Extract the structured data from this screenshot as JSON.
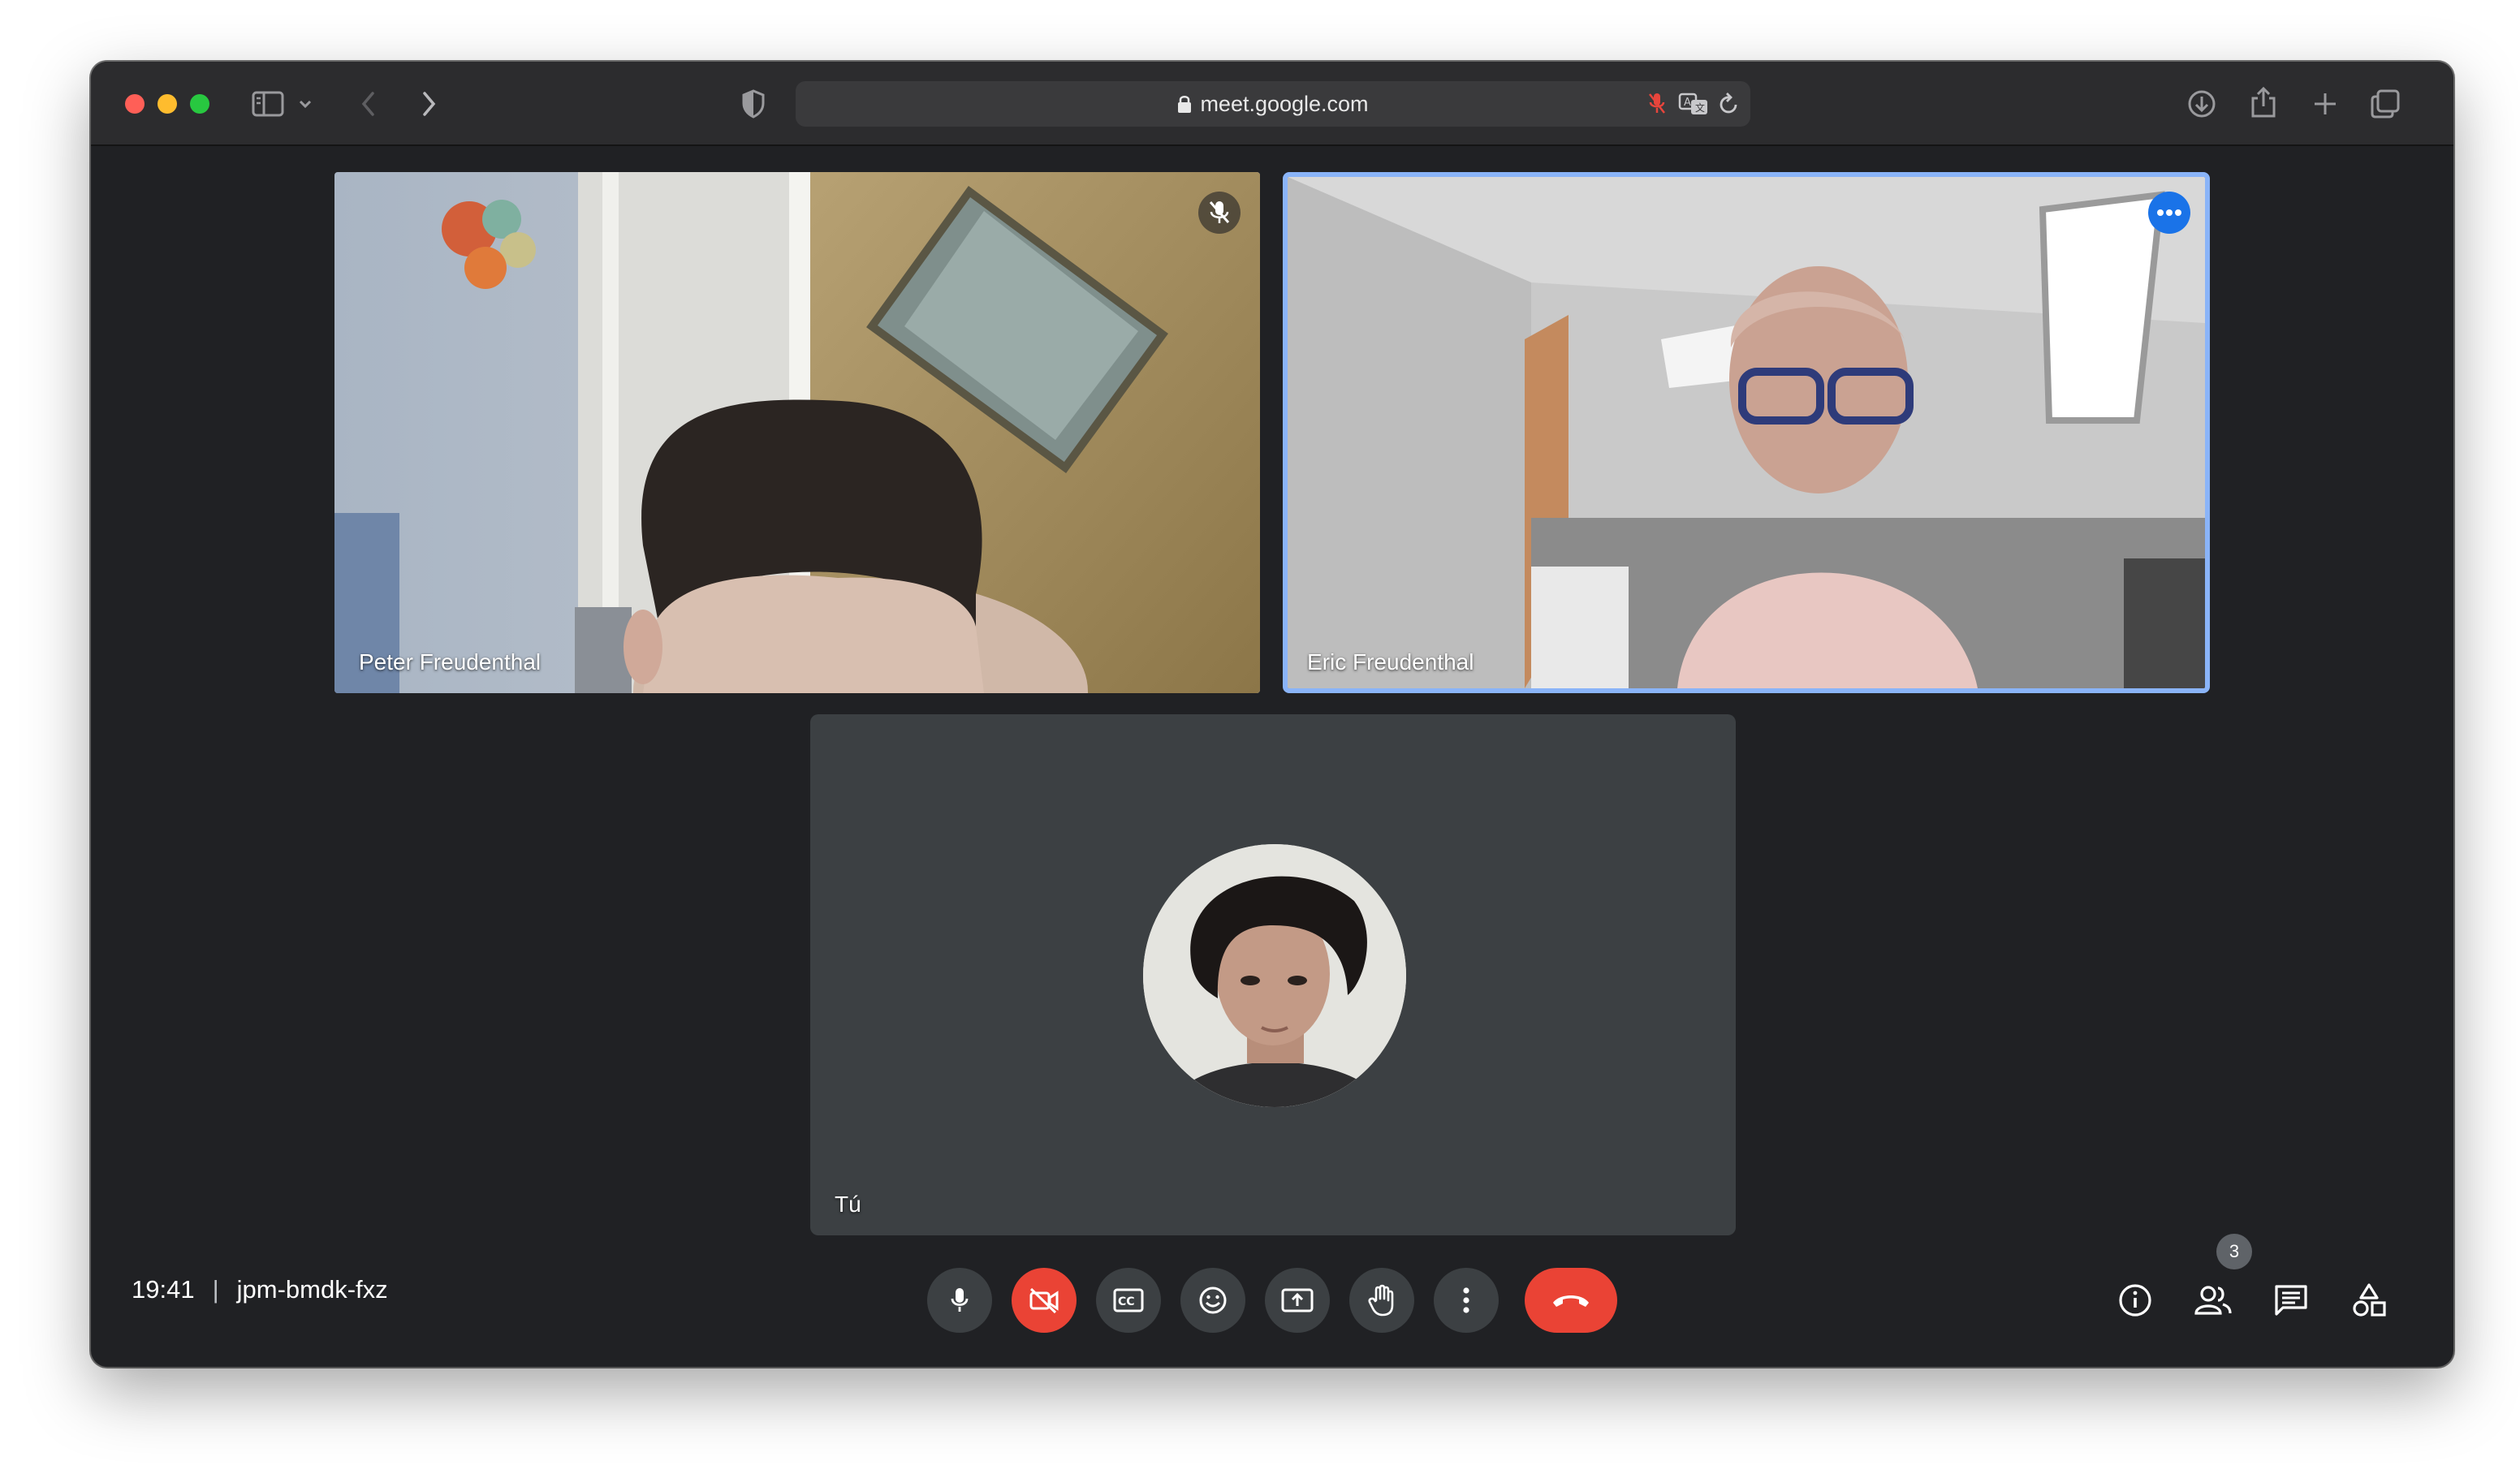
{
  "browser": {
    "url": "meet.google.com",
    "icons": [
      "sidebar-icon",
      "chevron-down-icon",
      "back-icon",
      "forward-icon",
      "shield-icon",
      "lock-icon",
      "mic-blocked-icon",
      "translate-icon",
      "reload-icon",
      "download-icon",
      "share-icon",
      "new-tab-icon",
      "tabs-overview-icon"
    ]
  },
  "participants": [
    {
      "name": "Peter Freudenthal",
      "muted": true
    },
    {
      "name": "Eric Freudenthal",
      "speaking": true
    },
    {
      "name": "Tú",
      "camera_off": true
    }
  ],
  "meeting": {
    "time": "19:41",
    "separator": "|",
    "code": "jpm-bmdk-fxz",
    "participant_count": "3"
  },
  "controls": [
    "mic-icon",
    "camera-off-icon",
    "captions-icon",
    "emoji-icon",
    "present-screen-icon",
    "raise-hand-icon",
    "more-options-icon",
    "end-call-icon"
  ],
  "side_icons": [
    "info-icon",
    "people-icon",
    "chat-icon",
    "activities-icon"
  ],
  "colors": {
    "accent": "#8ab4f8",
    "danger": "#ea4335",
    "surface": "#3c4043",
    "background": "#202124"
  }
}
